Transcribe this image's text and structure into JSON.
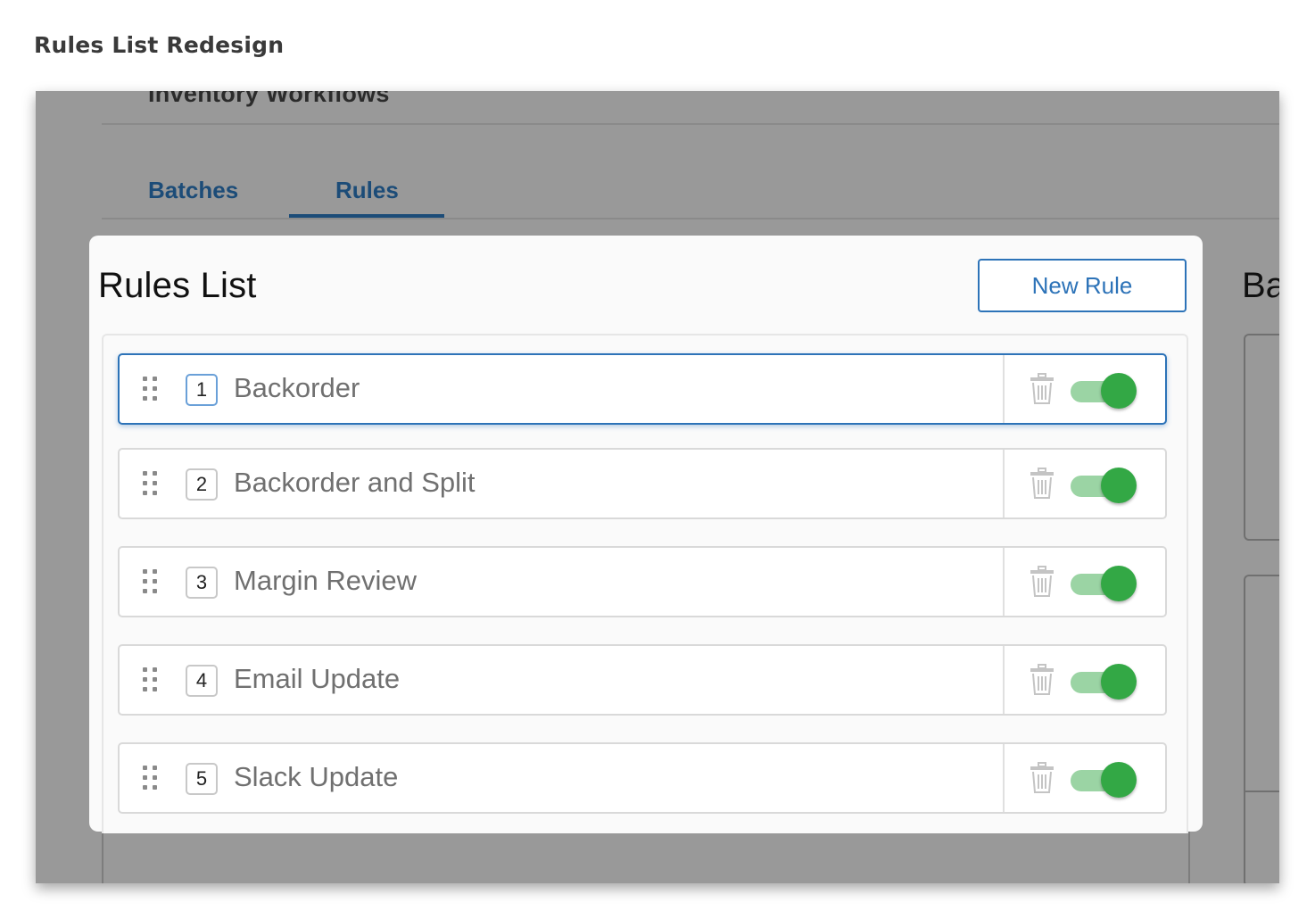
{
  "document_title": "Rules List Redesign",
  "app": {
    "title": "Inventory Workflows",
    "tabs": [
      {
        "label": "Batches",
        "active": false
      },
      {
        "label": "Rules",
        "active": true
      }
    ],
    "right_panel_title": "Ba"
  },
  "rules_panel": {
    "title": "Rules List",
    "new_rule_label": "New Rule",
    "rules": [
      {
        "number": "1",
        "name": "Backorder",
        "enabled": true,
        "selected": true
      },
      {
        "number": "2",
        "name": "Backorder and Split",
        "enabled": true,
        "selected": false
      },
      {
        "number": "3",
        "name": "Margin Review",
        "enabled": true,
        "selected": false
      },
      {
        "number": "4",
        "name": "Email Update",
        "enabled": true,
        "selected": false
      },
      {
        "number": "5",
        "name": "Slack Update",
        "enabled": true,
        "selected": false
      }
    ]
  },
  "colors": {
    "accent": "#2d73b8",
    "tab_color": "#1c4c78",
    "toggle_on": "#33a845",
    "toggle_track": "#9bd4a4",
    "overlay": "#999999"
  },
  "icons": {
    "drag": "drag-handle-icon",
    "delete": "trash-icon"
  }
}
